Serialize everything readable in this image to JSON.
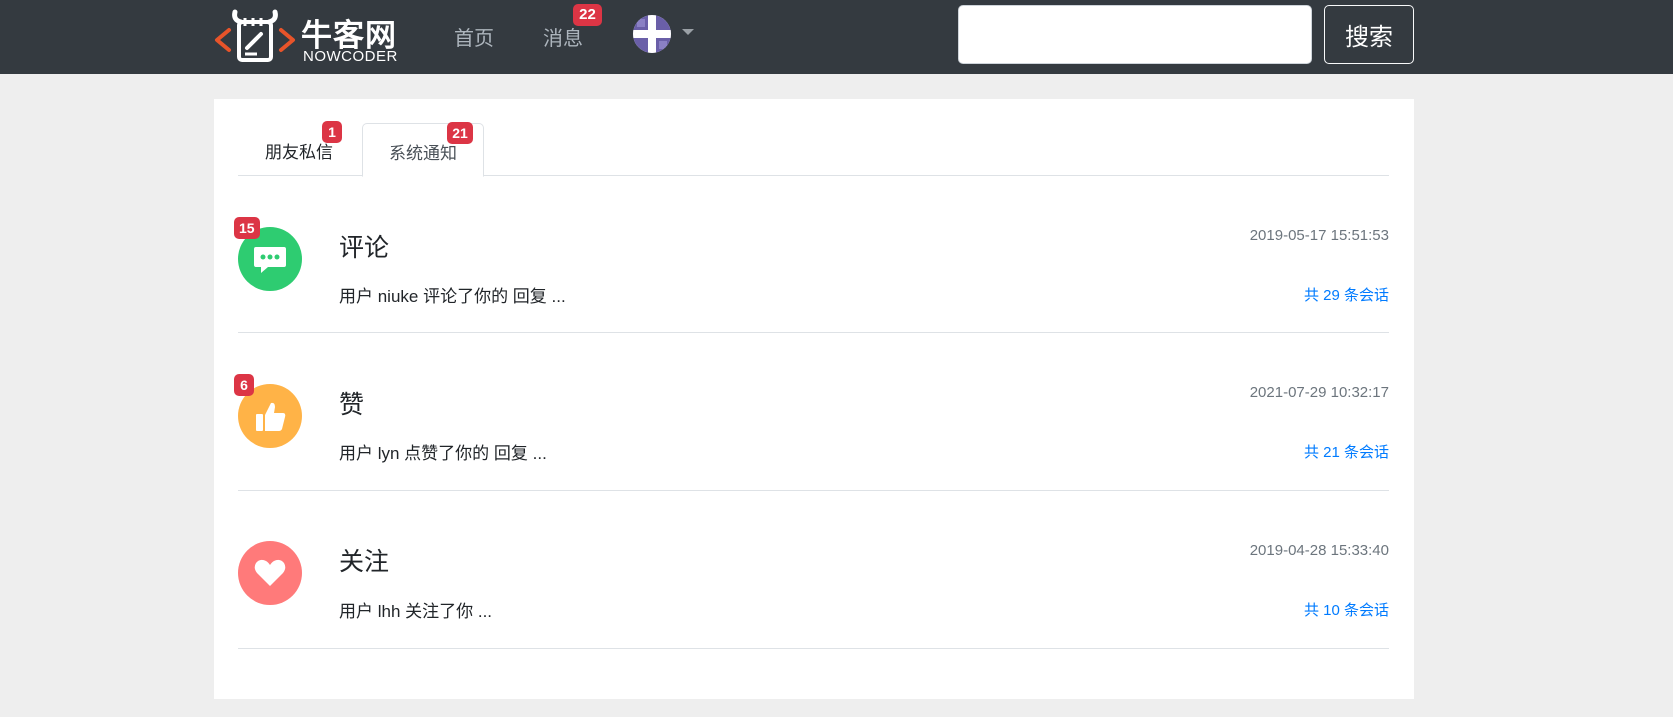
{
  "header": {
    "logo_text": "牛客网",
    "logo_subtext": "NOWCODER",
    "nav_home": "首页",
    "nav_messages": "消息",
    "messages_badge": "22",
    "search_placeholder": "",
    "search_button": "搜索"
  },
  "tabs": [
    {
      "label": "朋友私信",
      "badge": "1"
    },
    {
      "label": "系统通知",
      "badge": "21",
      "active": true
    }
  ],
  "notices": [
    {
      "type": "comment",
      "icon": "chat-bubble-icon",
      "title": "评论",
      "badge": "15",
      "time": "2019-05-17 15:51:53",
      "description": "用户 niuke 评论了你的 回复 ...",
      "count_text": "共 29 条会话"
    },
    {
      "type": "like",
      "icon": "thumbs-up-icon",
      "title": "赞",
      "badge": "6",
      "time": "2021-07-29 10:32:17",
      "description": "用户 lyn 点赞了你的 回复 ...",
      "count_text": "共 21 条会话"
    },
    {
      "type": "follow",
      "icon": "heart-icon",
      "title": "关注",
      "badge": "",
      "time": "2019-04-28 15:33:40",
      "description": "用户 lhh 关注了你 ...",
      "count_text": "共 10 条会话"
    }
  ],
  "colors": {
    "navbar": "#343a40",
    "badge": "#dc3545",
    "link": "#007bff",
    "comment_circle": "#2ecc71",
    "like_circle": "#ffb347",
    "follow_circle": "#ff7a7a"
  }
}
